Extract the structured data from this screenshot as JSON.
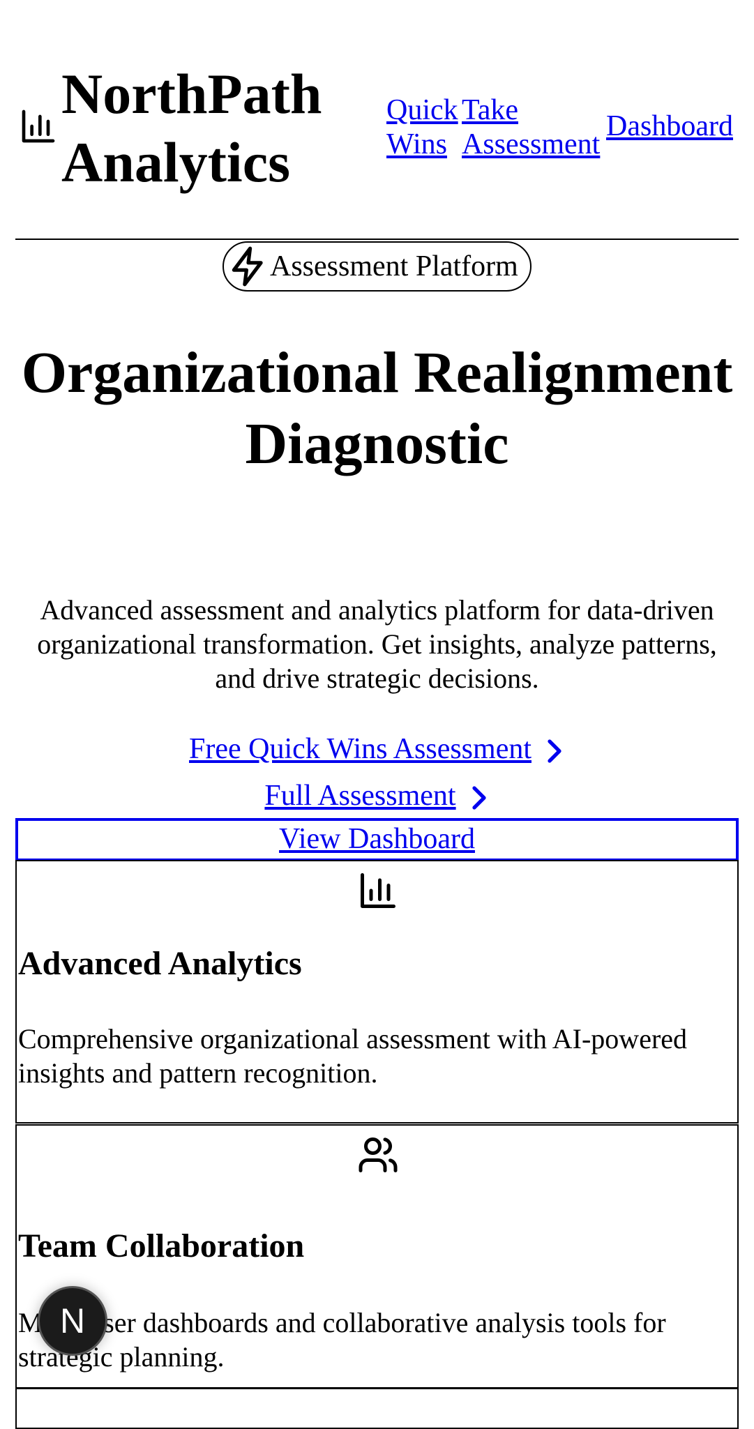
{
  "header": {
    "brand_title": "NorthPath Analytics",
    "brand_icon": "bar-chart-icon",
    "nav": {
      "quick_wins": "Quick Wins",
      "take_assessment": "Take Assessment",
      "dashboard": "Dashboard"
    }
  },
  "badge": {
    "icon": "lightning-icon",
    "label": "Assessment Platform"
  },
  "hero": {
    "title": "Organizational Realignment Diagnostic",
    "description": "Advanced assessment and analytics platform for data-driven organizational transformation. Get insights, analyze patterns, and drive strategic decisions."
  },
  "cta": {
    "quick_wins": "Free Quick Wins Assessment",
    "full": "Full Assessment",
    "dashboard": "View Dashboard"
  },
  "features": [
    {
      "icon": "bar-chart-icon",
      "title": "Advanced Analytics",
      "text": "Comprehensive organizational assessment with AI-powered insights and pattern recognition."
    },
    {
      "icon": "users-icon",
      "title": "Team Collaboration",
      "text": "Multi-user dashboards and collaborative analysis tools for strategic planning."
    }
  ],
  "next_badge": {
    "letter": "N"
  },
  "colors": {
    "link": "#0000ee",
    "border": "#000000",
    "badge_bg": "#1b1b1b"
  }
}
